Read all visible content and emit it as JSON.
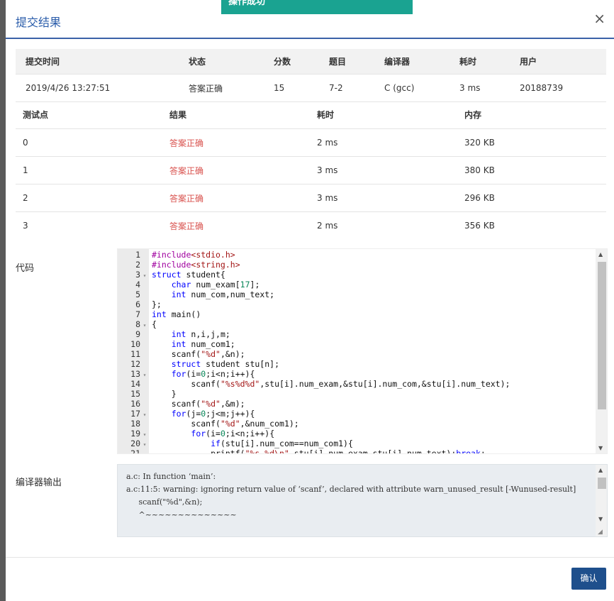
{
  "toast": "操作成功",
  "modal": {
    "title": "提交结果",
    "close": "×"
  },
  "summary": {
    "headers": [
      "提交时间",
      "状态",
      "分数",
      "题目",
      "编译器",
      "耗时",
      "用户"
    ],
    "row": {
      "time": "2019/4/26 13:27:51",
      "status": "答案正确",
      "score": "15",
      "problem": "7-2",
      "compiler": "C (gcc)",
      "elapsed": "3 ms",
      "user": "20188739"
    }
  },
  "tests": {
    "headers": [
      "测试点",
      "结果",
      "耗时",
      "内存"
    ],
    "rows": [
      {
        "id": "0",
        "result": "答案正确",
        "time": "2 ms",
        "memory": "320 KB"
      },
      {
        "id": "1",
        "result": "答案正确",
        "time": "3 ms",
        "memory": "380 KB"
      },
      {
        "id": "2",
        "result": "答案正确",
        "time": "3 ms",
        "memory": "296 KB"
      },
      {
        "id": "3",
        "result": "答案正确",
        "time": "2 ms",
        "memory": "356 KB"
      }
    ]
  },
  "code_label": "代码",
  "code_lines": [
    "#include<stdio.h>",
    "#include<string.h>",
    "struct student{",
    "    char num_exam[17];",
    "    int num_com,num_text;",
    "};",
    "int main()",
    "{",
    "    int n,i,j,m;",
    "    int num_com1;",
    "    scanf(\"%d\",&n);",
    "    struct student stu[n];",
    "    for(i=0;i<n;i++){",
    "        scanf(\"%s%d%d\",stu[i].num_exam,&stu[i].num_com,&stu[i].num_text);",
    "    }",
    "    scanf(\"%d\",&m);",
    "    for(j=0;j<m;j++){",
    "        scanf(\"%d\",&num_com1);",
    "        for(i=0;i<n;i++){",
    "            if(stu[i].num_com==num_com1){",
    "            printf(\"%s %d\\n\",stu[i].num_exam,stu[i].num_text);break;"
  ],
  "fold_lines": [
    3,
    8,
    13,
    17,
    19,
    20
  ],
  "compiler_label": "编译器输出",
  "compiler_output": [
    "a.c: In function ‘main’:",
    "a.c:11:5: warning: ignoring return value of ‘scanf’, declared with attribute warn_unused_result [-Wunused-result]",
    "     scanf(\"%d\",&n);",
    "     ^~~~~~~~~~~~~~~"
  ],
  "confirm_button": "确认",
  "colors": {
    "toast": "#1aa391",
    "title": "#2a5caa",
    "accepted": "#d9534f",
    "button": "#1e4f8c"
  }
}
